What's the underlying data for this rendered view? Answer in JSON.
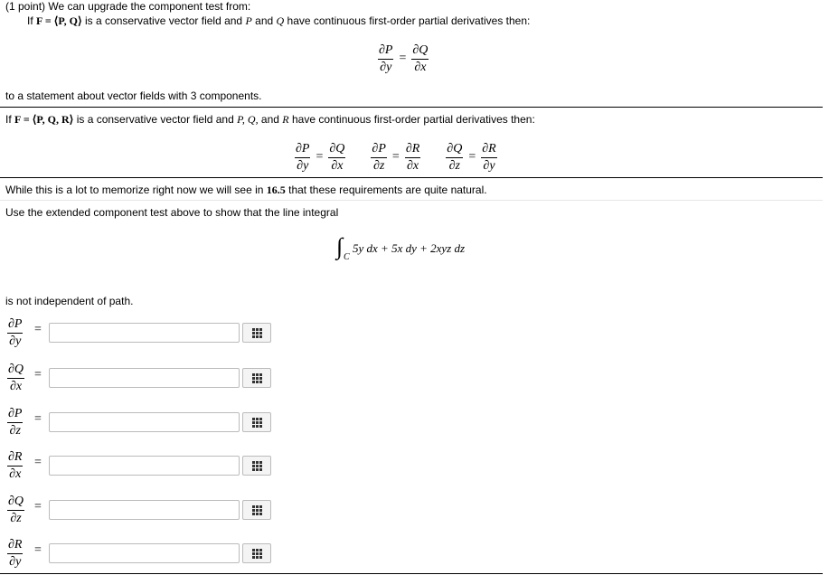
{
  "header": {
    "points": "(1 point) We can upgrade the component test from:",
    "intro_prefix": "If",
    "intro_field": "F = ⟨P, Q⟩",
    "intro_suffix": "is a conservative vector field and",
    "intro_P": "P",
    "intro_and": "and",
    "intro_Q": "Q",
    "intro_tail": "have continuous first-order partial derivatives then:"
  },
  "eq2d": {
    "num1": "∂P",
    "den1": "∂y",
    "num2": "∂Q",
    "den2": "∂x",
    "eq": "="
  },
  "statement3": "to a statement about vector fields with 3 components.",
  "intro3": {
    "prefix": "If",
    "field": "F = ⟨P, Q, R⟩",
    "mid": "is a conservative vector field and",
    "vars": "P, Q,",
    "and": "and",
    "R": "R",
    "tail": "have continuous first-order partial derivatives then:"
  },
  "eq3d": [
    {
      "num1": "∂P",
      "den1": "∂y",
      "num2": "∂Q",
      "den2": "∂x"
    },
    {
      "num1": "∂P",
      "den1": "∂z",
      "num2": "∂R",
      "den2": "∂x"
    },
    {
      "num1": "∂Q",
      "den1": "∂z",
      "num2": "∂R",
      "den2": "∂y"
    }
  ],
  "memorize": {
    "pre": "While this is a lot to memorize right now we will see in",
    "section": "16.5",
    "post": "that these requirements are quite natural."
  },
  "instruction": "Use the extended component test above to show that the line integral",
  "integral": {
    "sign": "∫",
    "sub": "C",
    "expr": "5y dx + 5x dy + 2xyz dz"
  },
  "conclusion": "is not independent of path.",
  "answers": [
    {
      "num": "∂P",
      "den": "∂y",
      "value": "",
      "placeholder": ""
    },
    {
      "num": "∂Q",
      "den": "∂x",
      "value": "",
      "placeholder": ""
    },
    {
      "num": "∂P",
      "den": "∂z",
      "value": "",
      "placeholder": ""
    },
    {
      "num": "∂R",
      "den": "∂x",
      "value": "",
      "placeholder": ""
    },
    {
      "num": "∂Q",
      "den": "∂z",
      "value": "",
      "placeholder": ""
    },
    {
      "num": "∂R",
      "den": "∂y",
      "value": "",
      "placeholder": ""
    }
  ],
  "eq_symbol": "=",
  "icons": {
    "answer_tool": "grid-icon"
  }
}
